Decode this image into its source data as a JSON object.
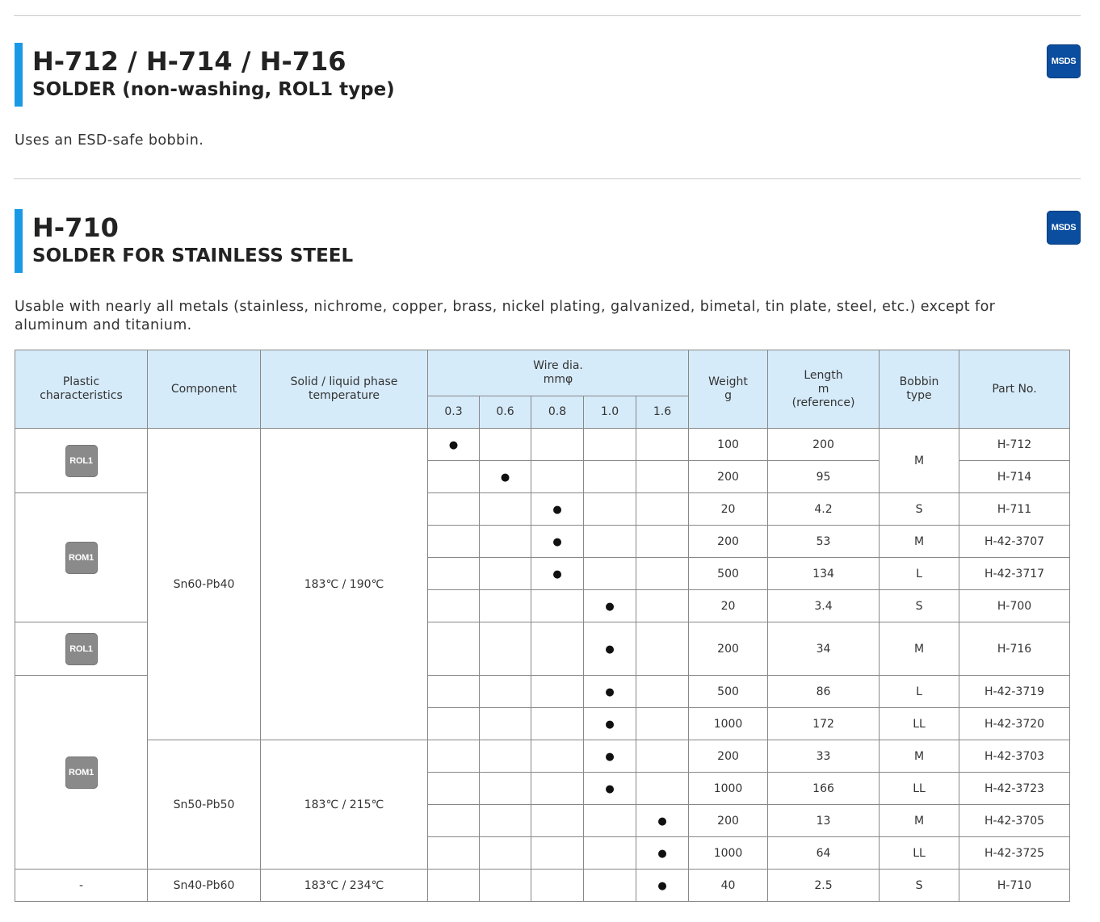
{
  "products": [
    {
      "code": "H-712 / H-714 / H-716",
      "subtitle": "SOLDER (non-washing, ROL1 type)",
      "msds_label": "MSDS",
      "description": "Uses an ESD-safe bobbin."
    },
    {
      "code": "H-710",
      "subtitle": "SOLDER FOR STAINLESS STEEL",
      "msds_label": "MSDS",
      "description": "Usable with nearly all metals (stainless, nichrome, copper, brass, nickel plating, galvanized, bimetal, tin plate, steel, etc.) except for aluminum and titanium."
    }
  ],
  "table": {
    "headers": {
      "plastic": "Plastic characteristics",
      "component": "Component",
      "temperature": "Solid / liquid phase temperature",
      "wire_title": "Wire dia.",
      "wire_unit": "mmφ",
      "wire_sizes": [
        "0.3",
        "0.6",
        "0.8",
        "1.0",
        "1.6"
      ],
      "weight_title": "Weight",
      "weight_unit": "g",
      "length_title": "Length",
      "length_unit": "m",
      "length_note": "(reference)",
      "bobbin_title": "Bobbin",
      "bobbin_sub": "type",
      "part": "Part No."
    },
    "mark": "●",
    "plastic_groups": [
      {
        "label": "ROL1",
        "icon": "rol1-badge",
        "rows": 2
      },
      {
        "label": "ROM1",
        "icon": "rom1-badge",
        "rows": 4
      },
      {
        "label": "ROL1",
        "icon": "rol1-badge",
        "rows": 1
      },
      {
        "label": "ROM1",
        "icon": "rom1-badge",
        "rows": 6
      },
      {
        "label": "-",
        "icon": "",
        "rows": 1
      }
    ],
    "component_groups": [
      {
        "component": "Sn60-Pb40",
        "temperature": "183℃ / 190℃",
        "rows": 9
      },
      {
        "component": "Sn50-Pb50",
        "temperature": "183℃ / 215℃",
        "rows": 4
      },
      {
        "component": "Sn40-Pb60",
        "temperature": "183℃ / 234℃",
        "rows": 1
      }
    ],
    "rows": [
      {
        "wire": "0.3",
        "weight": "100",
        "length": "200",
        "bobbin": "M",
        "part": "H-712"
      },
      {
        "wire": "0.6",
        "weight": "200",
        "length": "95",
        "bobbin": "M",
        "part": "H-714"
      },
      {
        "wire": "0.8",
        "weight": "20",
        "length": "4.2",
        "bobbin": "S",
        "part": "H-711"
      },
      {
        "wire": "0.8",
        "weight": "200",
        "length": "53",
        "bobbin": "M",
        "part": "H-42-3707"
      },
      {
        "wire": "0.8",
        "weight": "500",
        "length": "134",
        "bobbin": "L",
        "part": "H-42-3717"
      },
      {
        "wire": "1.0",
        "weight": "20",
        "length": "3.4",
        "bobbin": "S",
        "part": "H-700"
      },
      {
        "wire": "1.0",
        "weight": "200",
        "length": "34",
        "bobbin": "M",
        "part": "H-716"
      },
      {
        "wire": "1.0",
        "weight": "500",
        "length": "86",
        "bobbin": "L",
        "part": "H-42-3719"
      },
      {
        "wire": "1.0",
        "weight": "1000",
        "length": "172",
        "bobbin": "LL",
        "part": "H-42-3720"
      },
      {
        "wire": "1.0",
        "weight": "200",
        "length": "33",
        "bobbin": "M",
        "part": "H-42-3703"
      },
      {
        "wire": "1.0",
        "weight": "1000",
        "length": "166",
        "bobbin": "LL",
        "part": "H-42-3723"
      },
      {
        "wire": "1.6",
        "weight": "200",
        "length": "13",
        "bobbin": "M",
        "part": "H-42-3705"
      },
      {
        "wire": "1.6",
        "weight": "1000",
        "length": "64",
        "bobbin": "LL",
        "part": "H-42-3725"
      },
      {
        "wire": "1.6",
        "weight": "40",
        "length": "2.5",
        "bobbin": "S",
        "part": "H-710"
      }
    ]
  }
}
